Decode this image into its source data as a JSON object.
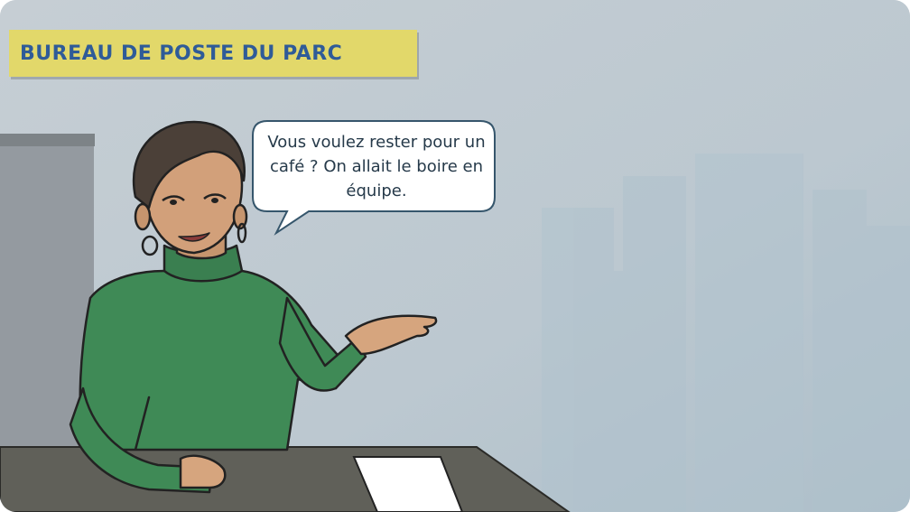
{
  "scene": {
    "location_label": "BUREAU DE POSTE DU PARC",
    "speech_bubble": "Vous voulez rester pour un café ? On allait le boire en équipe."
  },
  "colors": {
    "banner_bg": "#e2d86a",
    "banner_text": "#2f5b98",
    "wall": "#c3ccd2",
    "sweater": "#3f8a56",
    "desk": "#5f5f58",
    "bubble_text": "#263a4a"
  },
  "icons": [
    "woman-character",
    "speech-bubble",
    "paper-sheet"
  ]
}
